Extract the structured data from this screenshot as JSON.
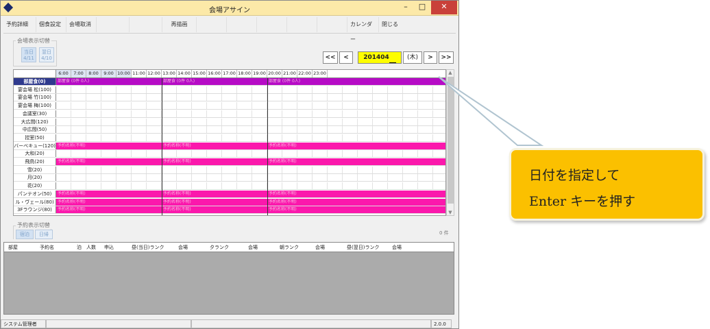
{
  "window": {
    "title": "会場アサイン",
    "min": "–",
    "max": "□",
    "close": "✕"
  },
  "toolbar": {
    "items": [
      "予約詳細",
      "個食設定",
      "会場取消",
      "",
      "",
      "再描画",
      "",
      "",
      "",
      "",
      "",
      "カレンダー",
      "閉じる"
    ]
  },
  "display_switch": {
    "label": "会場表示切替",
    "today": "当日",
    "today_date": "4/11",
    "next": "翌日",
    "next_date": "4/10"
  },
  "nav": {
    "first": "<<",
    "prev": "<",
    "date": "201404",
    "dow": "(木)",
    "next": ">",
    "last": ">>"
  },
  "grid": {
    "hours": [
      "6:00",
      "7:00",
      "8:00",
      "9:00",
      "10:00",
      "11:00",
      "12:00",
      "13:00",
      "14:00",
      "15:00",
      "16:00",
      "17:00",
      "18:00",
      "19:00",
      "20:00",
      "21:00",
      "22:00",
      "23:00"
    ],
    "rooms": [
      "部屋食(0)",
      "宴会場 松(100)",
      "宴会場 竹(100)",
      "宴会場 梅(100)",
      "会議室(30)",
      "大広間(120)",
      "中広間(50)",
      "控室(50)",
      "バーベキュー(120)",
      "大和(20)",
      "飛鳥(20)",
      "雪(20)",
      "月(20)",
      "花(20)",
      "パンテオン(50)",
      "ル・ヴェール(80)",
      "3Fラウンジ(80)"
    ],
    "bar_text": "予約名称(不明)",
    "bar_text_head": "部屋食 (0件 0人)"
  },
  "reserve_switch": {
    "label": "予約表示切替",
    "stay": "宿泊",
    "day": "日帰",
    "count": "0 件"
  },
  "list_headers": [
    "部屋",
    "予約名",
    "泊",
    "人数",
    "申込",
    "昼(当日)ランク",
    "会場",
    "夕ランク",
    "会場",
    "朝ランク",
    "会場",
    "昼(翌日)ランク",
    "会場"
  ],
  "status": {
    "user": "システム管理者",
    "version": "2.0.0"
  },
  "callout": {
    "line1": "日付を指定して",
    "line2": "Enter キーを押す"
  },
  "colors": {
    "magenta": "#fb18ac",
    "purple": "#b60bc6",
    "highlight": "#fdfd00",
    "callout": "#fbc000"
  }
}
